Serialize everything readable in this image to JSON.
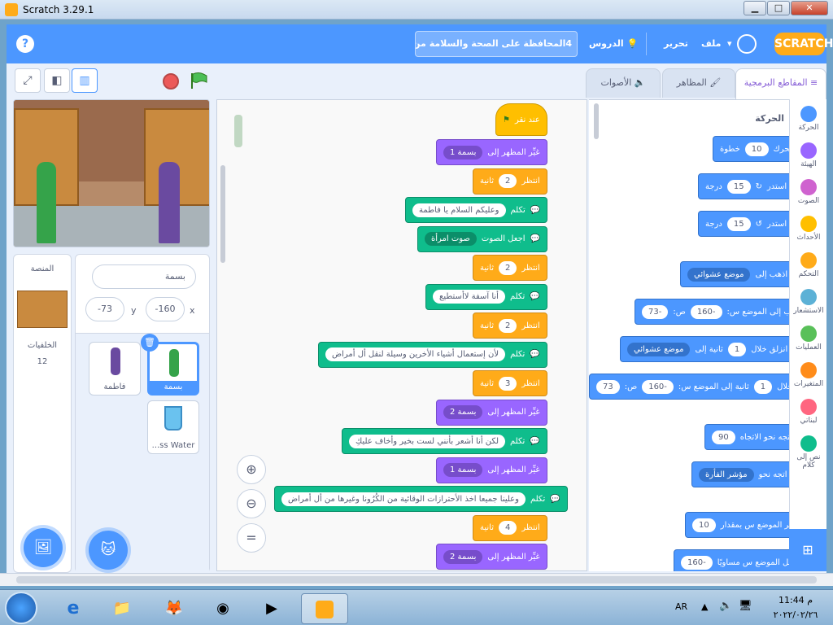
{
  "window": {
    "title": "Scratch 3.29.1",
    "min": "▁",
    "max": "□",
    "close": "✕"
  },
  "menubar": {
    "logo": "SCRATCH",
    "file": "ملف",
    "edit": "تحرير",
    "tutorials": "الدروس",
    "project_title": "4المحافظة على الصحة والسلامة من ا..."
  },
  "tabs": {
    "code": "المقاطع البرمجية",
    "costumes": "المظاهر",
    "sounds": "الأصوات"
  },
  "sprite_info": {
    "name": "بسمة",
    "x_label": "x",
    "x_value": "-160",
    "y_label": "y",
    "y_value": "-73"
  },
  "stage_panel": {
    "title": "المنصة",
    "backdrops_label": "الخلفيات",
    "backdrops_count": "12"
  },
  "sprites": [
    {
      "name": "بسمة",
      "selected": true
    },
    {
      "name": "فاطمة",
      "selected": false
    },
    {
      "name": "...ss Water",
      "selected": false
    }
  ],
  "script_blocks": [
    {
      "type": "event",
      "text": "عند نقر"
    },
    {
      "type": "looks",
      "text": "غيِّر المظهر إلى",
      "arg": "بسمة 1"
    },
    {
      "type": "ctrl",
      "text": "انتظر",
      "arg": "2",
      "unit": "ثانية"
    },
    {
      "type": "ext",
      "text": "تكلم",
      "arg": "وعليكم السلام يا فاطمة"
    },
    {
      "type": "ext",
      "text": "اجعل الصوت",
      "arg": "صوت امرأة"
    },
    {
      "type": "ctrl",
      "text": "انتظر",
      "arg": "2",
      "unit": "ثانية"
    },
    {
      "type": "ext",
      "text": "تكلم",
      "arg": "أنا  آسفة لاأستطيع"
    },
    {
      "type": "ctrl",
      "text": "انتظر",
      "arg": "2",
      "unit": "ثانية"
    },
    {
      "type": "ext",
      "text": "تكلم",
      "arg": "لأن إستعمال أشياء الأخرين وسيلة لنقل أل أمراض"
    },
    {
      "type": "ctrl",
      "text": "انتظر",
      "arg": "3",
      "unit": "ثانية"
    },
    {
      "type": "looks",
      "text": "غيِّر المظهر إلى",
      "arg": "بسمة 2"
    },
    {
      "type": "ext",
      "text": "تكلم",
      "arg": "لكن أنا أشعر بأنني لست بخير وأخاف عليكِ"
    },
    {
      "type": "looks",
      "text": "غيِّر المظهر إلى",
      "arg": "بسمة 1"
    },
    {
      "type": "ext",
      "text": "تكلم",
      "arg": "وعلينا جميعا اخذ الأحترازات الوقائية من الكُرُونا وغيرها من أل أمراض"
    },
    {
      "type": "ctrl",
      "text": "انتظر",
      "arg": "4",
      "unit": "ثانية"
    },
    {
      "type": "looks",
      "text": "غيِّر المظهر إلى",
      "arg": "بسمة 2"
    }
  ],
  "palette": {
    "section": "الحركة",
    "move": {
      "text": "تحرك",
      "arg": "10",
      "unit": "خطوة"
    },
    "turn_right": {
      "text": "استدر",
      "arg": "15",
      "unit": "درجة"
    },
    "turn_left": {
      "text": "استدر",
      "arg": "15",
      "unit": "درجة"
    },
    "goto": {
      "text": "اذهب إلى",
      "arg": "موضع عشوائي"
    },
    "goto_xy": {
      "text": "اذهب إلى الموضع س:",
      "x": "-160",
      "y_label": "ص:",
      "y": "-73"
    },
    "glide": {
      "text": "انزلق خلال",
      "arg": "1",
      "unit": "ثانية إلى",
      "target": "موضع عشوائي"
    },
    "glide_xy": {
      "text": "انزلق خلال",
      "arg": "1",
      "unit": "ثانية إلى الموضع س:",
      "x": "-160",
      "y_label": "ص:",
      "y": "73"
    },
    "point_dir": {
      "text": "اتجه نحو الاتجاه",
      "arg": "90"
    },
    "point_towards": {
      "text": "اتجه نحو",
      "arg": "مؤشر الفأرة"
    },
    "change_x": {
      "text": "غيِّر الموضع س بمقدار",
      "arg": "10"
    },
    "set_x": {
      "text": "اجعل الموضع س مساويًا",
      "arg": "-160"
    }
  },
  "categories": [
    {
      "label": "الحركة",
      "color": "#4c97ff"
    },
    {
      "label": "الهيئة",
      "color": "#9966ff"
    },
    {
      "label": "الصوت",
      "color": "#cf63cf"
    },
    {
      "label": "الأحداث",
      "color": "#ffbf00"
    },
    {
      "label": "التحكم",
      "color": "#ffab19"
    },
    {
      "label": "الاستشعار",
      "color": "#5cb1d6"
    },
    {
      "label": "العمليات",
      "color": "#59c059"
    },
    {
      "label": "المتغيرات",
      "color": "#ff8c1a"
    },
    {
      "label": "لبناتي",
      "color": "#ff6680"
    },
    {
      "label": "نص إلى كلام",
      "color": "#0fbd8c"
    }
  ],
  "taskbar": {
    "lang": "AR",
    "time": "11:44 م",
    "date": "٢٠٢٢/٠٢/٢٦"
  }
}
